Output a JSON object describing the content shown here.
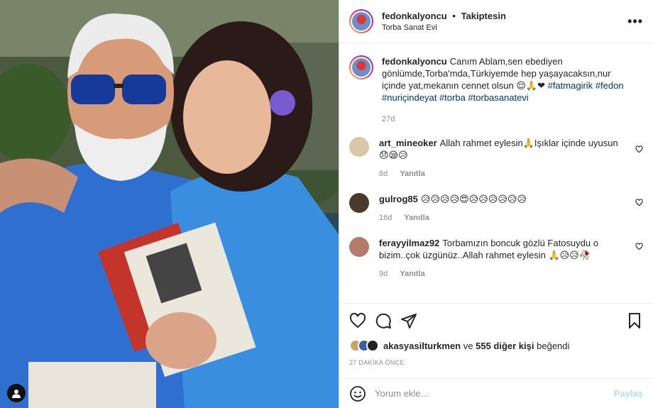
{
  "header": {
    "username": "fedonkalyoncu",
    "separator": "•",
    "follow_status": "Takiptesin",
    "location": "Torba Sanat Evi",
    "more_label": "•••"
  },
  "caption": {
    "username": "fedonkalyoncu",
    "text": "Canım Ablam,sen ebediyen gönlümde,Torba'mda,Türkiyemde hep yaşayacaksın,nur içinde yat,mekanın cennet olsun 😌🙏❤ ",
    "hashtags": "#fatmagirik #fedon #nuriçindeyat #torba #torbasanatevi",
    "age": "27d"
  },
  "comments": [
    {
      "username": "art_mineoker",
      "text": "Allah rahmet eylesin🙏Işıklar içinde uyusun😞😪😥",
      "age": "8d",
      "reply_label": "Yanıtla",
      "avatar_color": "#d9c8a8"
    },
    {
      "username": "gulrog85",
      "text": "😥😥😥😥😍😥😥😥😥😥😥",
      "age": "16d",
      "reply_label": "Yanıtla",
      "avatar_color": "#4a3a2c"
    },
    {
      "username": "ferayyilmaz92",
      "text": "Torbamızın boncuk gözlü Fatosuydu o bizim..çok üzgünüz..Allah rahmet eylesin 🙏😥😥🥀",
      "age": "9d",
      "reply_label": "Yanıtla",
      "avatar_color": "#b67a6a"
    }
  ],
  "likes": {
    "liker": "akasyasilturkmen",
    "connector": "ve",
    "others": "555 diğer kişi",
    "suffix": "beğendi"
  },
  "timestamp": "27 DAKİKA ÖNCE",
  "add_comment": {
    "placeholder": "Yorum ekle...",
    "post_label": "Paylaş"
  },
  "colors": {
    "hashtag": "#00376b",
    "muted": "#8e8e8e",
    "post_disabled": "#b2dffc"
  }
}
